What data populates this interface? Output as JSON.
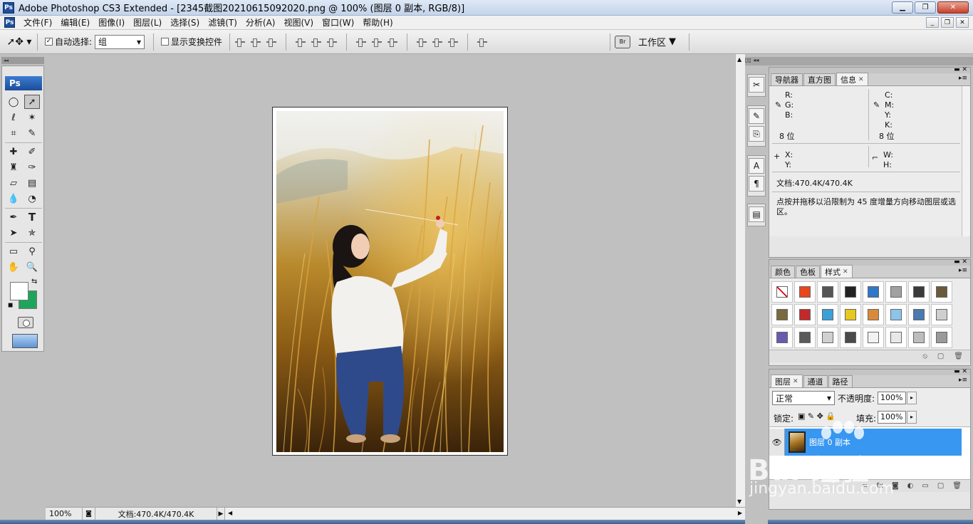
{
  "window": {
    "title": "Adobe Photoshop CS3 Extended - [2345截图20210615092020.png @ 100% (图层 0 副本, RGB/8)]",
    "app_icon": "Ps"
  },
  "menu": [
    "文件(F)",
    "编辑(E)",
    "图像(I)",
    "图层(L)",
    "选择(S)",
    "滤镜(T)",
    "分析(A)",
    "视图(V)",
    "窗口(W)",
    "帮助(H)"
  ],
  "options_bar": {
    "auto_select_label": "自动选择:",
    "auto_select_value": "组",
    "show_transform_label": "显示变换控件",
    "workspace_label": "工作区"
  },
  "toolbox": {
    "logo": "Ps",
    "foreground_color": "#ffffff",
    "background_color": "#1fa55b"
  },
  "status_bar": {
    "zoom": "100%",
    "doc_info": "文档:470.4K/470.4K"
  },
  "info_panel": {
    "tabs": [
      "导航器",
      "直方图",
      "信息"
    ],
    "active_tab": "信息",
    "r": "R:",
    "g": "G:",
    "b": "B:",
    "c": "C:",
    "m": "M:",
    "y": "Y:",
    "k": "K:",
    "bits_left": "8 位",
    "bits_right": "8 位",
    "x": "X:",
    "y2": "Y:",
    "w": "W:",
    "h": "H:",
    "doc": "文档:470.4K/470.4K",
    "hint": "点按并拖移以沿限制为 45 度增量方向移动图层或选区。"
  },
  "styles_panel": {
    "tabs": [
      "颜色",
      "色板",
      "样式"
    ],
    "active_tab": "样式",
    "swatches": [
      "#ffffff",
      "#e8461c",
      "#555555",
      "#222222",
      "#2d78c8",
      "#a0a0a0",
      "#3a3a3a",
      "#6b5a3a",
      "#7a6a3c",
      "#c22a2a",
      "#3ca0d8",
      "#e6c81e",
      "#d88a3a",
      "#8cc4ea",
      "#4a7ab0",
      "#cfcfcf",
      "#6a5ab0",
      "#5a5a5a",
      "#d0d0d0",
      "#4a4a4a",
      "#f2f2f2",
      "#e8e8e8",
      "#bdbdbd",
      "#9a9a9a"
    ]
  },
  "layers_panel": {
    "tabs": [
      "图层",
      "通道",
      "路径"
    ],
    "active_tab": "图层",
    "blend_mode": "正常",
    "opacity_label": "不透明度:",
    "opacity": "100%",
    "lock_label": "锁定:",
    "fill_label": "填充:",
    "fill": "100%",
    "layer_name": "图层 0 副本"
  },
  "watermark": {
    "logo": "Bai 经验",
    "url": "jingyan.baidu.com"
  }
}
